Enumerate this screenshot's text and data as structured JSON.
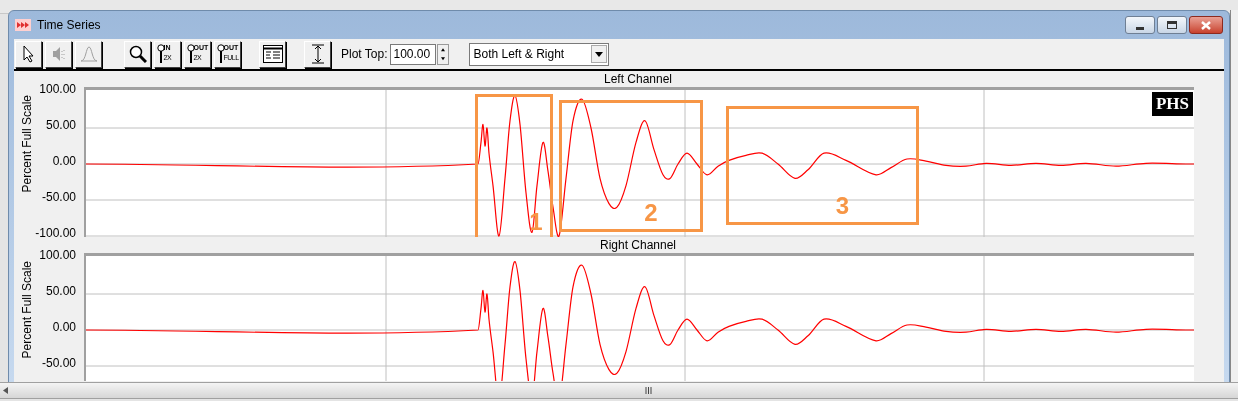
{
  "window": {
    "title": "Time Series"
  },
  "toolbar": {
    "groups": [
      [
        {
          "kind": "pointer",
          "disabled": false
        },
        {
          "kind": "speaker",
          "disabled": true
        },
        {
          "kind": "peak",
          "disabled": true
        }
      ],
      [
        {
          "kind": "zoom",
          "disabled": false
        },
        {
          "kind": "zoom-text",
          "disabled": false,
          "top": "IN",
          "bottom": "2X"
        },
        {
          "kind": "zoom-text",
          "disabled": false,
          "top": "OUT",
          "bottom": "2X"
        },
        {
          "kind": "zoom-text",
          "disabled": false,
          "top": "OUT",
          "bottom": "FULL"
        }
      ],
      [
        {
          "kind": "legend",
          "disabled": false
        }
      ],
      [
        {
          "kind": "fit-height",
          "disabled": false
        }
      ]
    ],
    "plot_top": {
      "label": "Plot Top:",
      "value": "100.00"
    },
    "channel_select": {
      "value": "Both Left & Right"
    }
  },
  "panels": [
    {
      "title": "Left Channel",
      "ylabel": "Percent Full Scale",
      "yticks": [
        "100.00",
        "50.00",
        "0.00",
        "-50.00",
        "-100.00"
      ],
      "logo": "PHS",
      "annotations": [
        {
          "label": "1"
        },
        {
          "label": "2"
        },
        {
          "label": "3"
        }
      ]
    },
    {
      "title": "Right Channel",
      "ylabel": "Percent Full Scale",
      "yticks": [
        "100.00",
        "50.00",
        "0.00",
        "-50.00"
      ]
    }
  ]
}
